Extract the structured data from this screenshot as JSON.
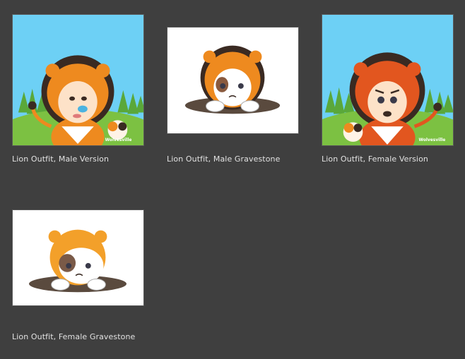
{
  "gallery": {
    "items": [
      {
        "caption": "Lion Outfit, Male Version",
        "image": "lion-male-version-icon",
        "watermark": "Wolvesville"
      },
      {
        "caption": "Lion Outfit, Male Gravestone",
        "image": "lion-male-gravestone-icon"
      },
      {
        "caption": "Lion Outfit, Female Version",
        "image": "lion-female-version-icon",
        "watermark": "Wolvesville"
      },
      {
        "caption": "Lion Outfit, Female Gravestone",
        "image": "lion-female-gravestone-icon"
      }
    ]
  },
  "colors": {
    "background": "#3f3f3f",
    "caption_text": "#e2e2e2",
    "sky": "#6dd0f5",
    "grass": "#7cc142",
    "lion_mane": "#3a2a22",
    "lion_orange": "#ee8a1f",
    "lion_red": "#e2561f"
  }
}
